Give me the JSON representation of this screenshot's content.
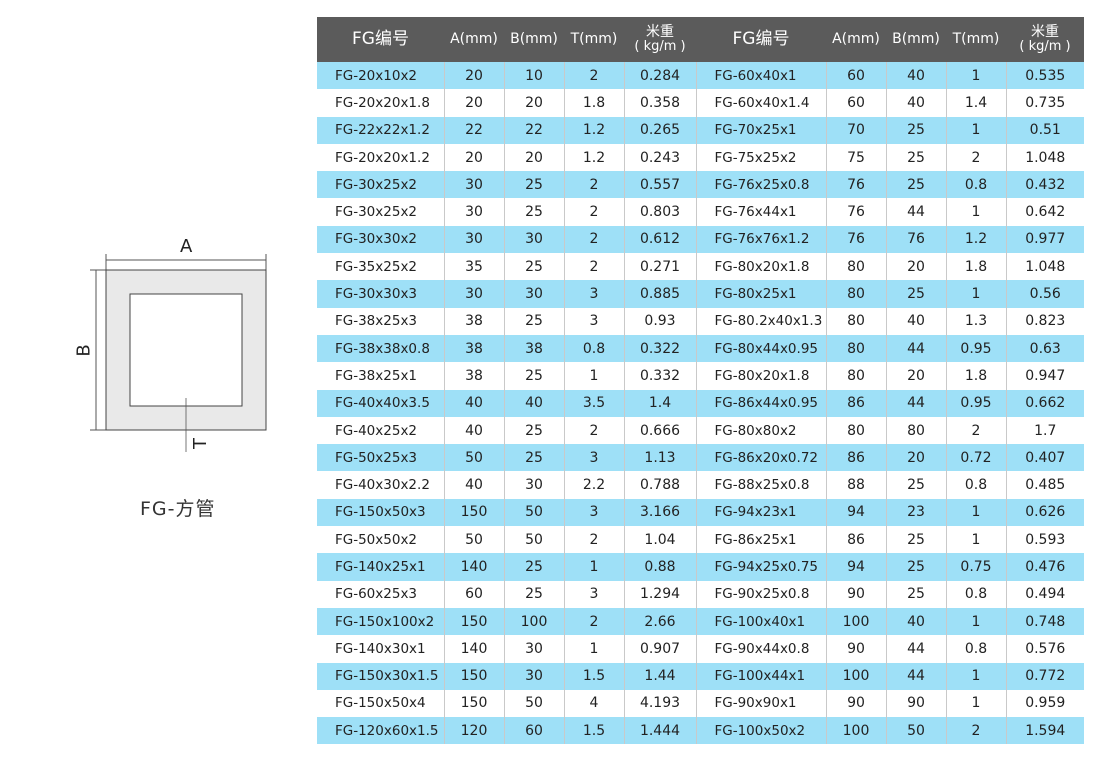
{
  "diagram": {
    "label_a": "A",
    "label_b": "B",
    "label_t": "T",
    "caption": "FG-方管"
  },
  "table": {
    "headers": {
      "code": "FG编号",
      "a": "A(mm)",
      "b": "B(mm)",
      "t": "T(mm)",
      "weight_top": "米重",
      "weight_unit": "( kg/m )"
    },
    "rows": [
      {
        "left": [
          "FG-20x10x2",
          "20",
          "10",
          "2",
          "0.284"
        ],
        "right": [
          "FG-60x40x1",
          "60",
          "40",
          "1",
          "0.535"
        ]
      },
      {
        "left": [
          "FG-20x20x1.8",
          "20",
          "20",
          "1.8",
          "0.358"
        ],
        "right": [
          "FG-60x40x1.4",
          "60",
          "40",
          "1.4",
          "0.735"
        ]
      },
      {
        "left": [
          "FG-22x22x1.2",
          "22",
          "22",
          "1.2",
          "0.265"
        ],
        "right": [
          "FG-70x25x1",
          "70",
          "25",
          "1",
          "0.51"
        ]
      },
      {
        "left": [
          "FG-20x20x1.2",
          "20",
          "20",
          "1.2",
          "0.243"
        ],
        "right": [
          "FG-75x25x2",
          "75",
          "25",
          "2",
          "1.048"
        ]
      },
      {
        "left": [
          "FG-30x25x2",
          "30",
          "25",
          "2",
          "0.557"
        ],
        "right": [
          "FG-76x25x0.8",
          "76",
          "25",
          "0.8",
          "0.432"
        ]
      },
      {
        "left": [
          "FG-30x25x2",
          "30",
          "25",
          "2",
          "0.803"
        ],
        "right": [
          "FG-76x44x1",
          "76",
          "44",
          "1",
          "0.642"
        ]
      },
      {
        "left": [
          "FG-30x30x2",
          "30",
          "30",
          "2",
          "0.612"
        ],
        "right": [
          "FG-76x76x1.2",
          "76",
          "76",
          "1.2",
          "0.977"
        ]
      },
      {
        "left": [
          "FG-35x25x2",
          "35",
          "25",
          "2",
          "0.271"
        ],
        "right": [
          "FG-80x20x1.8",
          "80",
          "20",
          "1.8",
          "1.048"
        ]
      },
      {
        "left": [
          "FG-30x30x3",
          "30",
          "30",
          "3",
          "0.885"
        ],
        "right": [
          "FG-80x25x1",
          "80",
          "25",
          "1",
          "0.56"
        ]
      },
      {
        "left": [
          "FG-38x25x3",
          "38",
          "25",
          "3",
          "0.93"
        ],
        "right": [
          "FG-80.2x40x1.3",
          "80",
          "40",
          "1.3",
          "0.823"
        ]
      },
      {
        "left": [
          "FG-38x38x0.8",
          "38",
          "38",
          "0.8",
          "0.322"
        ],
        "right": [
          "FG-80x44x0.95",
          "80",
          "44",
          "0.95",
          "0.63"
        ]
      },
      {
        "left": [
          "FG-38x25x1",
          "38",
          "25",
          "1",
          "0.332"
        ],
        "right": [
          "FG-80x20x1.8",
          "80",
          "20",
          "1.8",
          "0.947"
        ]
      },
      {
        "left": [
          "FG-40x40x3.5",
          "40",
          "40",
          "3.5",
          "1.4"
        ],
        "right": [
          "FG-86x44x0.95",
          "86",
          "44",
          "0.95",
          "0.662"
        ]
      },
      {
        "left": [
          "FG-40x25x2",
          "40",
          "25",
          "2",
          "0.666"
        ],
        "right": [
          "FG-80x80x2",
          "80",
          "80",
          "2",
          "1.7"
        ]
      },
      {
        "left": [
          "FG-50x25x3",
          "50",
          "25",
          "3",
          "1.13"
        ],
        "right": [
          "FG-86x20x0.72",
          "86",
          "20",
          "0.72",
          "0.407"
        ]
      },
      {
        "left": [
          "FG-40x30x2.2",
          "40",
          "30",
          "2.2",
          "0.788"
        ],
        "right": [
          "FG-88x25x0.8",
          "88",
          "25",
          "0.8",
          "0.485"
        ]
      },
      {
        "left": [
          "FG-150x50x3",
          "150",
          "50",
          "3",
          "3.166"
        ],
        "right": [
          "FG-94x23x1",
          "94",
          "23",
          "1",
          "0.626"
        ]
      },
      {
        "left": [
          "FG-50x50x2",
          "50",
          "50",
          "2",
          "1.04"
        ],
        "right": [
          "FG-86x25x1",
          "86",
          "25",
          "1",
          "0.593"
        ]
      },
      {
        "left": [
          "FG-140x25x1",
          "140",
          "25",
          "1",
          "0.88"
        ],
        "right": [
          "FG-94x25x0.75",
          "94",
          "25",
          "0.75",
          "0.476"
        ]
      },
      {
        "left": [
          "FG-60x25x3",
          "60",
          "25",
          "3",
          "1.294"
        ],
        "right": [
          "FG-90x25x0.8",
          "90",
          "25",
          "0.8",
          "0.494"
        ]
      },
      {
        "left": [
          "FG-150x100x2",
          "150",
          "100",
          "2",
          "2.66"
        ],
        "right": [
          "FG-100x40x1",
          "100",
          "40",
          "1",
          "0.748"
        ]
      },
      {
        "left": [
          "FG-140x30x1",
          "140",
          "30",
          "1",
          "0.907"
        ],
        "right": [
          "FG-90x44x0.8",
          "90",
          "44",
          "0.8",
          "0.576"
        ]
      },
      {
        "left": [
          "FG-150x30x1.5",
          "150",
          "30",
          "1.5",
          "1.44"
        ],
        "right": [
          "FG-100x44x1",
          "100",
          "44",
          "1",
          "0.772"
        ]
      },
      {
        "left": [
          "FG-150x50x4",
          "150",
          "50",
          "4",
          "4.193"
        ],
        "right": [
          "FG-90x90x1",
          "90",
          "90",
          "1",
          "0.959"
        ]
      },
      {
        "left": [
          "FG-120x60x1.5",
          "120",
          "60",
          "1.5",
          "1.444"
        ],
        "right": [
          "FG-100x50x2",
          "100",
          "50",
          "2",
          "1.594"
        ]
      }
    ]
  },
  "colors": {
    "header_bg": "#5b5b5b",
    "stripe_bg": "#9ee0f7",
    "diagram_fill": "#e9e9e9"
  }
}
